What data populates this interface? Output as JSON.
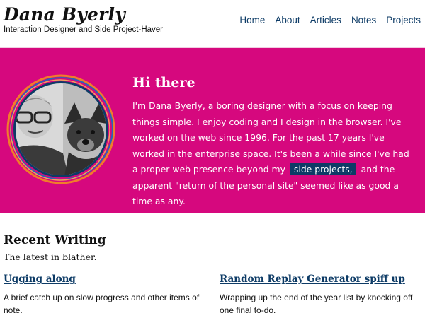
{
  "header": {
    "site_title": "Dana Byerly",
    "tagline": "Interaction Designer and Side Project-Haver",
    "nav": [
      "Home",
      "About",
      "Articles",
      "Notes",
      "Projects"
    ]
  },
  "hero": {
    "heading": "Hi there",
    "text_before_link": "I'm Dana Byerly, a boring designer with a focus on keeping things simple. I enjoy coding and I design in the browser. I've worked on the web since 1996. For the past 17 years I've worked in the enterprise space. It's been a while since I've had a proper web presence beyond my",
    "link_text": "side projects,",
    "text_after_link": "and the apparent \"return of the personal site\" seemed like as good a time as any.",
    "avatar_icon": "portrait-with-dog-icon"
  },
  "recent": {
    "title": "Recent Writing",
    "subtitle": "The latest in blather.",
    "posts": [
      {
        "title": "Ugging along",
        "excerpt": "A brief catch up on slow progress and other items of note."
      },
      {
        "title": "Random Replay Generator spiff up",
        "excerpt": "Wrapping up the end of the year list by knocking off one final to-do."
      }
    ]
  },
  "colors": {
    "hero_background": "#d6087e",
    "link": "#0d3b66",
    "avatar_ring_orange": "#f07d2a",
    "avatar_ring_blue": "#2a63b7"
  }
}
